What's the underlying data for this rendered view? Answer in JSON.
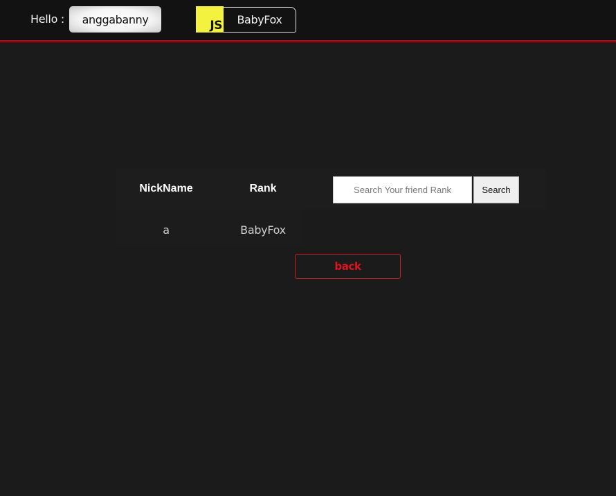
{
  "header": {
    "greeting": "Hello :",
    "username": "anggabanny",
    "logo_text": "JS",
    "rank_label": "BabyFox"
  },
  "table": {
    "columns": [
      "NickName",
      "Rank"
    ],
    "rows": [
      {
        "nickname": "a",
        "rank": "BabyFox"
      }
    ]
  },
  "search": {
    "placeholder": "Search Your friend Rank",
    "value": "",
    "button_label": "Search"
  },
  "actions": {
    "back_label": "back"
  },
  "colors": {
    "background": "#1b1b1b",
    "topbar": "#121212",
    "accent_red": "#e0141c",
    "logo_yellow": "#f3f33f"
  }
}
